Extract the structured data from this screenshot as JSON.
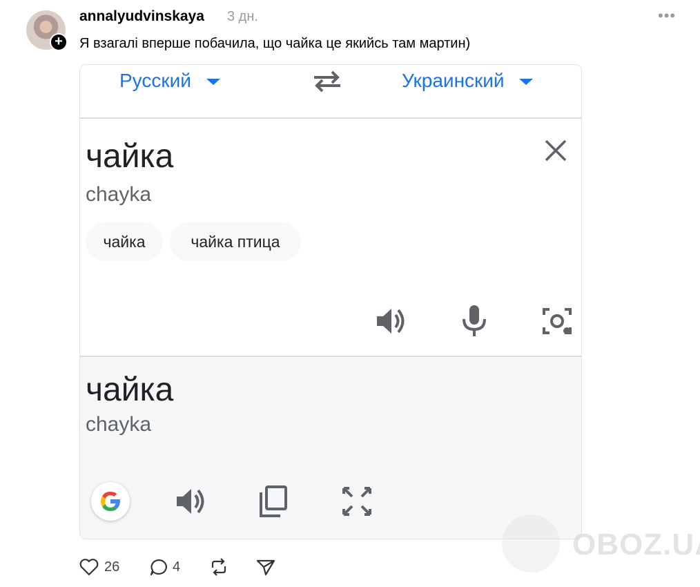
{
  "post": {
    "username": "annalyudvinskaya",
    "time": "3 дн.",
    "more": "•••",
    "text": "Я взагалі вперше побачила, що чайка це якийсь там мартин)"
  },
  "translate": {
    "source_lang": "Русский",
    "target_lang": "Украинский",
    "input_word": "чайка",
    "input_translit": "chayka",
    "suggestions": [
      "чайка",
      "чайка птица"
    ],
    "output_word": "чайка",
    "output_translit": "chayka",
    "accent_color": "#1a73e8"
  },
  "actions": {
    "likes": "26",
    "comments": "4"
  },
  "watermark": {
    "text": "OBOZ.UA"
  },
  "icons": [
    "plus-icon",
    "more-icon",
    "swap-icon",
    "close-icon",
    "speaker-icon",
    "mic-icon",
    "camera-icon",
    "google-icon",
    "copy-icon",
    "fullscreen-icon",
    "heart-icon",
    "comment-icon",
    "repost-icon",
    "share-icon"
  ]
}
